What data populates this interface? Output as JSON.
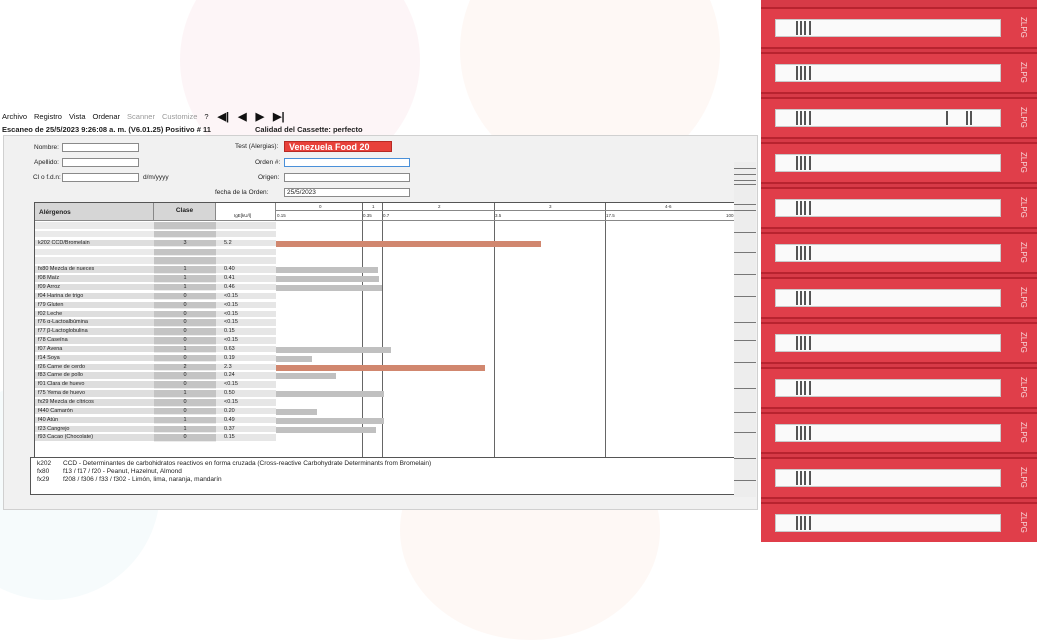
{
  "menu": {
    "items": [
      "Archivo",
      "Registro",
      "Vista",
      "Ordenar"
    ],
    "dim_items": [
      "Scanner",
      "Customize"
    ],
    "help": "?",
    "nav": [
      "◀|",
      "◀",
      "▶",
      "▶|"
    ]
  },
  "scan": {
    "line": "Escaneo de 25/5/2023 9:26:08 a. m. (V6.01.25)  Positivo # 11",
    "quality": "Calidad del Cassette:  perfecto"
  },
  "form": {
    "nombre_label": "Nombre:",
    "apellido_label": "Apellido:",
    "dob_label": "Cl o f.d.n:",
    "dob_hint": "d/m/yyyy",
    "test_label": "Test (Alergias):",
    "test_value": "Venezuela Food 20",
    "orden_label": "Orden #:",
    "origen_label": "Origen:",
    "fecha_label": "fecha de la Orden:",
    "fecha_value": "25/5/2023"
  },
  "table": {
    "col_alergenos": "Alérgenos",
    "col_clase": "Clase",
    "col_unit": "IgE[kU/l]",
    "class_ticks": [
      "0",
      "1",
      "2",
      "3",
      "4-6"
    ],
    "conc_ticks": [
      "0.15",
      "0.35",
      "0.7",
      "3.5",
      "17.5",
      "100"
    ],
    "rows": [
      {
        "name": "",
        "clase": "",
        "value": "",
        "bar": 0,
        "color": ""
      },
      {
        "name": "",
        "clase": "",
        "value": "",
        "bar": 0,
        "color": ""
      },
      {
        "name": "k202  CCD/Bromelain",
        "clase": "3",
        "value": "5.2",
        "bar": 5.2,
        "color": "#d1876f"
      },
      {
        "name": "",
        "clase": "",
        "value": "",
        "bar": 0,
        "color": ""
      },
      {
        "name": "",
        "clase": "",
        "value": "",
        "bar": 0,
        "color": ""
      },
      {
        "name": "fx80  Mezcla de nueces",
        "clase": "1",
        "value": "0.40",
        "bar": 0.4,
        "color": "#c0c0c0"
      },
      {
        "name": "f08  Maíz",
        "clase": "1",
        "value": "0.41",
        "bar": 0.41,
        "color": "#c0c0c0"
      },
      {
        "name": "f09  Arroz",
        "clase": "1",
        "value": "0.46",
        "bar": 0.46,
        "color": "#c0c0c0"
      },
      {
        "name": "f04  Harina de trigo",
        "clase": "0",
        "value": "<0.15",
        "bar": 0,
        "color": ""
      },
      {
        "name": "f79  Gluten",
        "clase": "0",
        "value": "<0.15",
        "bar": 0,
        "color": ""
      },
      {
        "name": "f02  Leche",
        "clase": "0",
        "value": "<0.15",
        "bar": 0,
        "color": ""
      },
      {
        "name": "f76  α-Lactoalbúmina",
        "clase": "0",
        "value": "<0.15",
        "bar": 0,
        "color": ""
      },
      {
        "name": "f77  β-Lactoglobulina",
        "clase": "0",
        "value": "0.15",
        "bar": 0,
        "color": ""
      },
      {
        "name": "f78  Caseína",
        "clase": "0",
        "value": "<0.15",
        "bar": 0,
        "color": ""
      },
      {
        "name": "f07  Avena",
        "clase": "1",
        "value": "0.63",
        "bar": 0.63,
        "color": "#c0c0c0"
      },
      {
        "name": "f14  Soya",
        "clase": "0",
        "value": "0.19",
        "bar": 0.19,
        "color": "#c0c0c0"
      },
      {
        "name": "f26  Carne de cerdo",
        "clase": "2",
        "value": "2.3",
        "bar": 2.3,
        "color": "#d1876f"
      },
      {
        "name": "f83  Carne de pollo",
        "clase": "0",
        "value": "0.24",
        "bar": 0.24,
        "color": "#c0c0c0"
      },
      {
        "name": "f01  Clara de huevo",
        "clase": "0",
        "value": "<0.15",
        "bar": 0,
        "color": ""
      },
      {
        "name": "f75  Yema de huevo",
        "clase": "1",
        "value": "0.50",
        "bar": 0.5,
        "color": "#c0c0c0"
      },
      {
        "name": "fx29  Mezcla de cítricos",
        "clase": "0",
        "value": "<0.15",
        "bar": 0,
        "color": ""
      },
      {
        "name": "f440  Camarón",
        "clase": "0",
        "value": "0.20",
        "bar": 0.2,
        "color": "#c0c0c0"
      },
      {
        "name": "f40  Atún",
        "clase": "1",
        "value": "0.49",
        "bar": 0.49,
        "color": "#c0c0c0"
      },
      {
        "name": "f23  Cangrejo",
        "clase": "1",
        "value": "0.37",
        "bar": 0.37,
        "color": "#c0c0c0"
      },
      {
        "name": "f93  Cacao (Chocolate)",
        "clase": "0",
        "value": "0.15",
        "bar": 0,
        "color": ""
      }
    ]
  },
  "notes": [
    {
      "code": "k202",
      "text": "CCD - Determinantes de carbohidratos reactivos en forma cruzada (Cross-reactive Carbohydrate Determinants from Bromelain)"
    },
    {
      "code": "fx80",
      "text": "f13 / f17 / f20 - Peanut, Hazelnut, Almond"
    },
    {
      "code": "fx29",
      "text": "f208 / f306 / f33 / f302 - Limón, lima, naranja, mandarín"
    }
  ],
  "strips": {
    "label": "ZLPG",
    "count": 12
  }
}
